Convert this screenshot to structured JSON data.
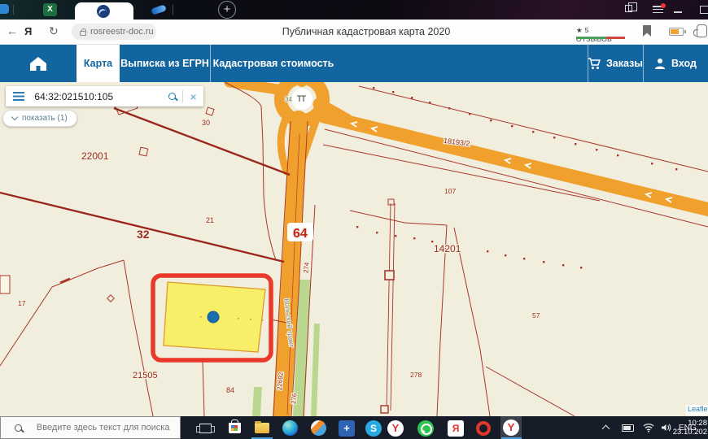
{
  "colors": {
    "nav_blue": "#12659e",
    "map_background": "#f2eedd",
    "road_orange": "#f0a02c",
    "parcel_line_red": "#a8372a",
    "selected_parcel_yellow": "#f8ef68",
    "selection_box_red": "#e8392b",
    "marker_blue": "#1b6fae",
    "green_strip": "#b9d78f"
  },
  "icons": {
    "new_tab": "+",
    "back_arrow": "←",
    "refresh": "↻",
    "yandex_letter": "Я",
    "star": "★",
    "close": "×",
    "skype_letter": "S",
    "yandex_y": "Y",
    "ya_browser_letter": "Я",
    "excel_letter": "X",
    "blue_app_glyph": "+"
  },
  "toolbar": {
    "url": "rosreestr-doc.ru",
    "title": "Публичная кадастровая карта 2020",
    "reviews": "5 отзывов"
  },
  "nav": {
    "tabs": [
      {
        "label": "Карта"
      },
      {
        "label": "Выписка из ЕГРН"
      },
      {
        "label": "Кадастровая стоимость"
      }
    ],
    "orders": "Заказы",
    "login": "Вход"
  },
  "search_panel": {
    "value": "64:32:021510:105",
    "show": "показать (1)"
  },
  "map": {
    "labels": [
      {
        "t": "30"
      },
      {
        "t": "22001"
      },
      {
        "t": "21"
      },
      {
        "t": "32"
      },
      {
        "t": "17"
      },
      {
        "t": "21505"
      },
      {
        "t": "84"
      },
      {
        "t": "64"
      },
      {
        "t": "274"
      },
      {
        "t": "Вольский тракт"
      },
      {
        "t": "22692"
      },
      {
        "t": "276"
      },
      {
        "t": "18193/2"
      },
      {
        "t": "107"
      },
      {
        "t": "14201"
      },
      {
        "t": "57"
      },
      {
        "t": "278"
      },
      {
        "t": "34"
      }
    ],
    "attribution": "Leaflet"
  },
  "taskbar": {
    "search_placeholder": "Введите здесь текст для поиска",
    "lang": "ENG",
    "time": "10:28",
    "date": "23.10.202"
  }
}
